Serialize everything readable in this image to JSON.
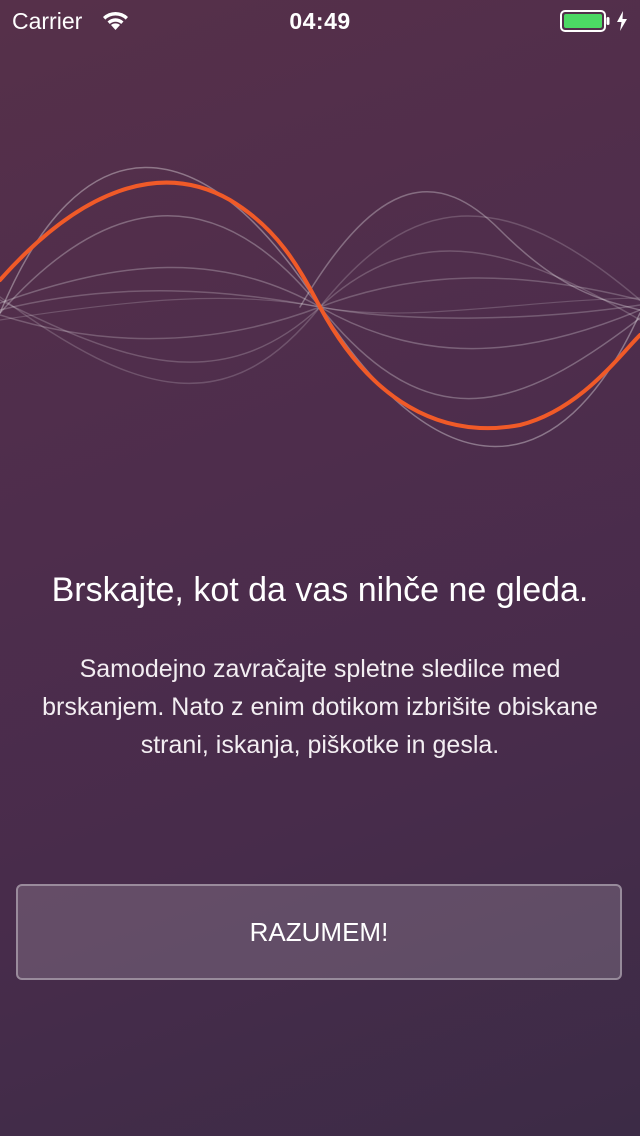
{
  "status_bar": {
    "carrier": "Carrier",
    "time": "04:49",
    "icons": [
      "wifi-icon",
      "battery-icon",
      "charging-icon"
    ],
    "battery_color": "#4cd964"
  },
  "hero": {
    "icon": "waveform-illustration",
    "accent_color": "#f05a28"
  },
  "headline": "Brskajte, kot da vas nihče ne gleda.",
  "body": "Samodejno zavračajte spletne sledilce med brskanjem. Nato z enim dotikom izbrišite obiskane strani, iskanja, piškotke in gesla.",
  "button": {
    "label": "RAZUMEM!"
  },
  "colors": {
    "background_start": "#56304a",
    "background_end": "#3c2b46"
  }
}
